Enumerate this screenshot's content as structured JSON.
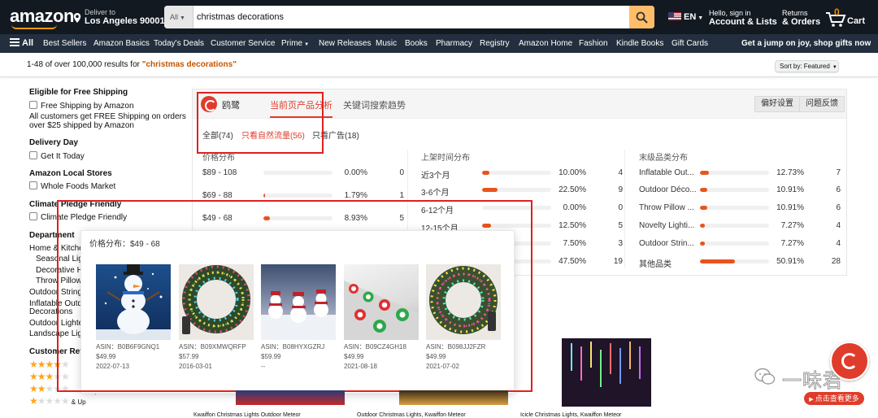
{
  "header": {
    "logo": "amazon",
    "deliver_line1": "Deliver to",
    "deliver_line2": "Los Angeles 90001",
    "search_category": "All",
    "search_value": "christmas decorations",
    "language": "EN",
    "account_line1": "Hello, sign in",
    "account_line2": "Account & Lists",
    "orders_line1": "Returns",
    "orders_line2": "& Orders",
    "cart_count": "0",
    "cart_label": "Cart"
  },
  "subnav": {
    "all": "All",
    "items": [
      "Best Sellers",
      "Amazon Basics",
      "Today's Deals",
      "Customer Service",
      "Prime",
      "New Releases",
      "Music",
      "Books",
      "Pharmacy",
      "Registry",
      "Amazon Home",
      "Fashion",
      "Kindle Books",
      "Gift Cards"
    ],
    "promo": "Get a jump on joy, shop gifts now"
  },
  "results": {
    "prefix": "1-48 of over 100,000 results for ",
    "query": "\"christmas decorations\"",
    "sort_label": "Sort by:  Featured"
  },
  "sidebar": {
    "free_shipping_heading": "Eligible for Free Shipping",
    "free_shipping_option": "Free Shipping by Amazon",
    "free_shipping_note1": "All customers get FREE Shipping on orders",
    "free_shipping_note2": "over $25 shipped by Amazon",
    "delivery_heading": "Delivery Day",
    "delivery_option": "Get It Today",
    "local_heading": "Amazon Local Stores",
    "local_option": "Whole Foods Market",
    "climate_heading": "Climate Pledge Friendly",
    "climate_option": "Climate Pledge Friendly",
    "department_heading": "Department",
    "department_items": [
      "Home & Kitche",
      "Seasonal Ligh",
      "Decorative H",
      "Throw Pillow",
      "Outdoor String",
      "Inflatable Outd",
      "Decorations",
      "Outdoor Lighte",
      "Landscape Ligh"
    ],
    "review_heading": "Customer Revi",
    "review_up": "& Up",
    "review_up_partial": "& Up"
  },
  "panel": {
    "brand": "鸥鹭",
    "tabs": [
      "当前页产品分析",
      "关键词搜索趋势"
    ],
    "active_tab": 0,
    "buttons": [
      "偏好设置",
      "问题反馈"
    ],
    "filters": [
      "全部(74)",
      "只看自然流量(56)",
      "只看广告(18)"
    ],
    "active_filter": 1,
    "columns": [
      {
        "title": "价格分布",
        "rows": [
          {
            "label": "$89 - 108",
            "fraction": 0.0,
            "pct": "0.00%",
            "count": "0"
          },
          {
            "label": "$69 - 88",
            "fraction": 0.0179,
            "pct": "1.79%",
            "count": "1"
          },
          {
            "label": "$49 - 68",
            "fraction": 0.0893,
            "pct": "8.93%",
            "count": "5"
          }
        ]
      },
      {
        "title": "上架时间分布",
        "rows": [
          {
            "label": "近3个月",
            "fraction": 0.1,
            "pct": "10.00%",
            "count": "4"
          },
          {
            "label": "3-6个月",
            "fraction": 0.225,
            "pct": "22.50%",
            "count": "9"
          },
          {
            "label": "6-12个月",
            "fraction": 0.0,
            "pct": "0.00%",
            "count": "0"
          },
          {
            "label": "12-15个月",
            "fraction": 0.125,
            "pct": "12.50%",
            "count": "5"
          },
          {
            "label": "",
            "fraction": 0.075,
            "pct": "7.50%",
            "count": "3"
          },
          {
            "label": "",
            "fraction": 0.475,
            "pct": "47.50%",
            "count": "19"
          }
        ]
      },
      {
        "title": "末级品类分布",
        "rows": [
          {
            "label": "Inflatable Out...",
            "fraction": 0.1273,
            "pct": "12.73%",
            "count": "7"
          },
          {
            "label": "Outdoor Déco...",
            "fraction": 0.1091,
            "pct": "10.91%",
            "count": "6"
          },
          {
            "label": "Throw Pillow ...",
            "fraction": 0.1091,
            "pct": "10.91%",
            "count": "6"
          },
          {
            "label": "Novelty Lighti...",
            "fraction": 0.0727,
            "pct": "7.27%",
            "count": "4"
          },
          {
            "label": "Outdoor Strin...",
            "fraction": 0.0727,
            "pct": "7.27%",
            "count": "4"
          },
          {
            "label": "其他品类",
            "fraction": 0.5091,
            "pct": "50.91%",
            "count": "28"
          }
        ]
      }
    ]
  },
  "popup": {
    "title": "价格分布：$49 - 68",
    "products": [
      {
        "image": "inflatable-snowman",
        "asin": "ASIN：B0B6F9GNQ1",
        "price": "$49.99",
        "date": "2022-07-13"
      },
      {
        "image": "light-wreath",
        "asin": "ASIN：B09XMWQRFP",
        "price": "$57.99",
        "date": "2016-03-01"
      },
      {
        "image": "snowman-yard-decor",
        "asin": "ASIN：B08HYXGZRJ",
        "price": "$59.99",
        "date": "--"
      },
      {
        "image": "candy-pathway-lights",
        "asin": "ASIN：B09CZ4GH18",
        "price": "$49.99",
        "date": "2021-08-18"
      },
      {
        "image": "light-wreath",
        "asin": "ASIN：B098JJ2FZR",
        "price": "$49.99",
        "date": "2021-07-02"
      }
    ]
  },
  "bottom_titles": [
    "Kwaiffon Christmas Lights Outdoor Meteor",
    "Outdoor Christmas Lights, Kwaiffon Meteor",
    "Icicle Christmas Lights, Kwaiffon Meteor"
  ],
  "watermark": {
    "text": "一味君",
    "button": "点击查看更多"
  },
  "colors": {
    "nav_dark": "#131921",
    "nav_sub": "#232f3e",
    "search_button": "#febd69",
    "accent_red": "#e03c2b",
    "bar_fill": "#e8541e",
    "annotation_red": "#e02020",
    "query_orange": "#c45500"
  }
}
